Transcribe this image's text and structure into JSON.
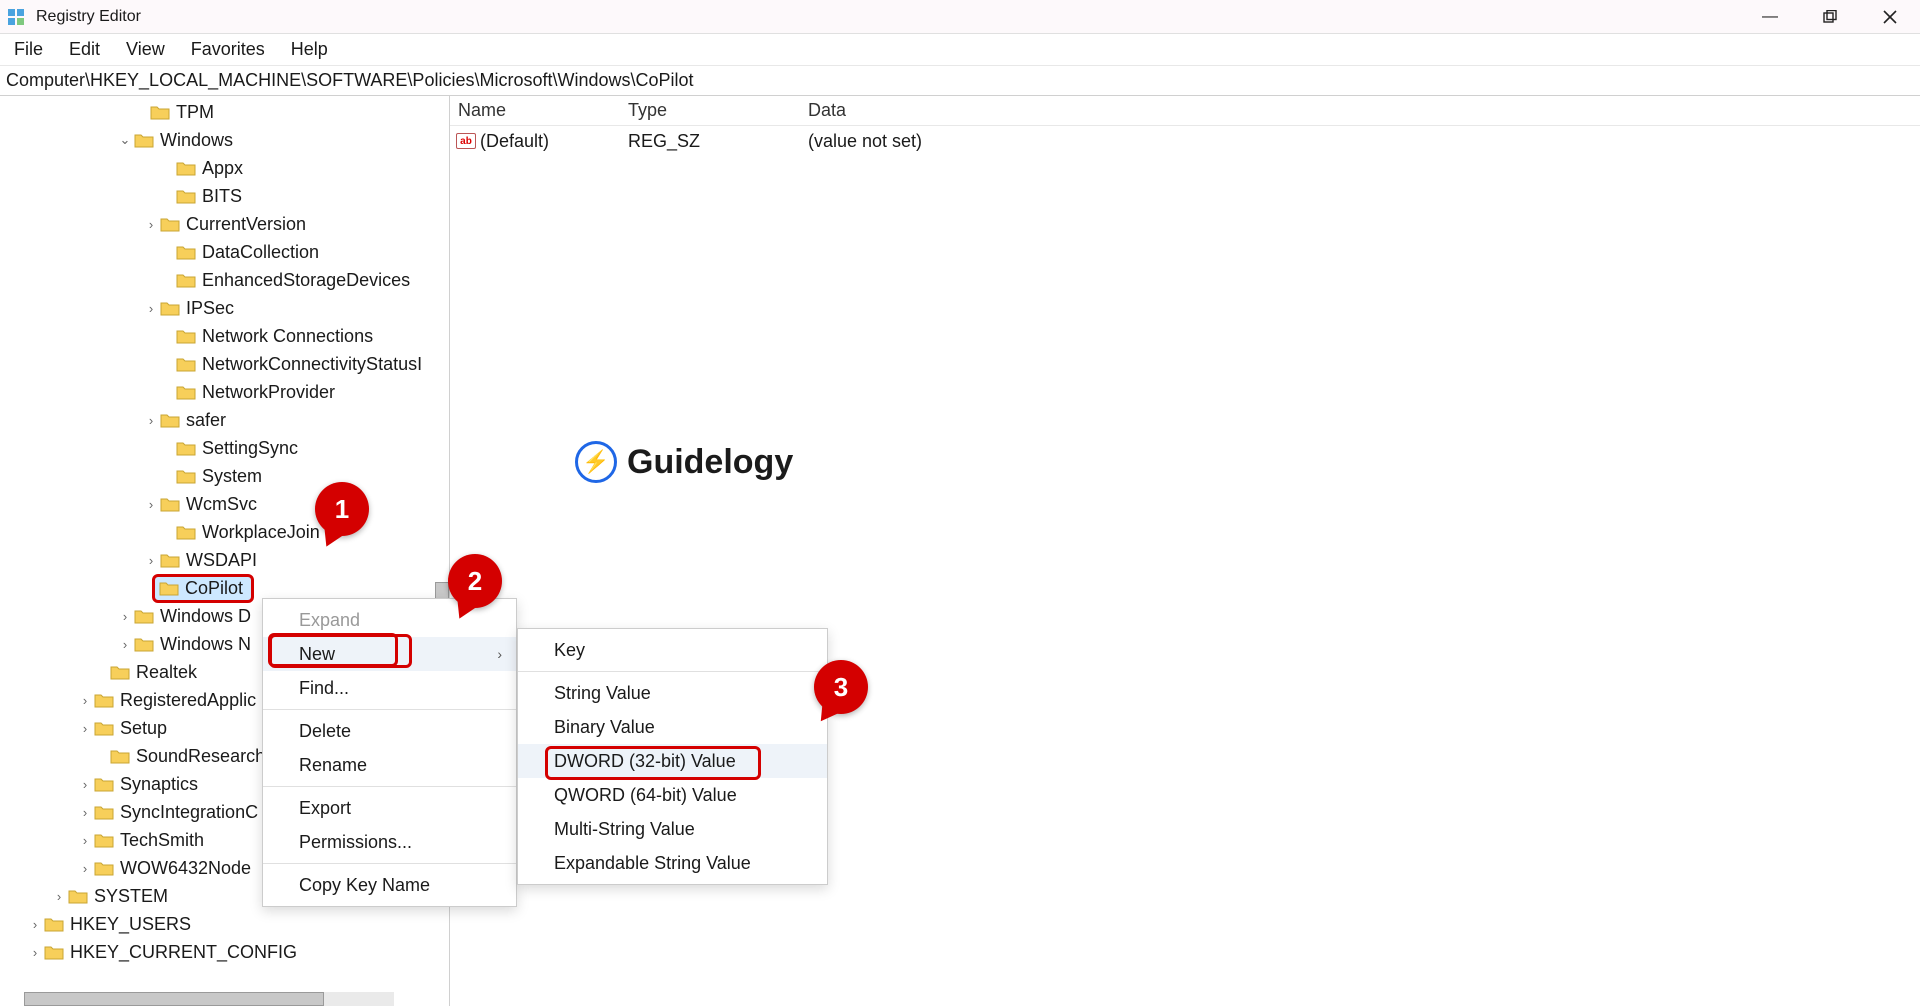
{
  "window": {
    "title": "Registry Editor"
  },
  "menu": {
    "file": "File",
    "edit": "Edit",
    "view": "View",
    "favorites": "Favorites",
    "help": "Help"
  },
  "address": "Computer\\HKEY_LOCAL_MACHINE\\SOFTWARE\\Policies\\Microsoft\\Windows\\CoPilot",
  "tree": {
    "tpm": "TPM",
    "windows": "Windows",
    "appx": "Appx",
    "bits": "BITS",
    "currentversion": "CurrentVersion",
    "datacollection": "DataCollection",
    "enhanced": "EnhancedStorageDevices",
    "ipsec": "IPSec",
    "netconn": "Network Connections",
    "netconnstat": "NetworkConnectivityStatusI",
    "netprov": "NetworkProvider",
    "safer": "safer",
    "settingsync": "SettingSync",
    "system": "System",
    "wcmsvc": "WcmSvc",
    "workplace": "WorkplaceJoin",
    "wsdapi": "WSDAPI",
    "copilot": "CoPilot",
    "windowsd": "Windows D",
    "windowsn": "Windows N",
    "realtek": "Realtek",
    "regapp": "RegisteredApplic",
    "setup": "Setup",
    "soundres": "SoundResearch",
    "synaptics": "Synaptics",
    "syncint": "SyncIntegrationC",
    "techsmith": "TechSmith",
    "wow64": "WOW6432Node",
    "hsystem": "SYSTEM",
    "hkeyusers": "HKEY_USERS",
    "hkeycc": "HKEY_CURRENT_CONFIG"
  },
  "list": {
    "h_name": "Name",
    "h_type": "Type",
    "h_data": "Data",
    "r0_name": "(Default)",
    "r0_type": "REG_SZ",
    "r0_data": "(value not set)"
  },
  "ctx1": {
    "expand": "Expand",
    "new": "New",
    "find": "Find...",
    "delete": "Delete",
    "rename": "Rename",
    "export": "Export",
    "permissions": "Permissions...",
    "copykey": "Copy Key Name"
  },
  "ctx2": {
    "key": "Key",
    "string": "String Value",
    "binary": "Binary Value",
    "dword": "DWORD (32-bit) Value",
    "qword": "QWORD (64-bit) Value",
    "multi": "Multi-String Value",
    "expand": "Expandable String Value"
  },
  "watermark": "Guidelogy",
  "badges": {
    "b1": "1",
    "b2": "2",
    "b3": "3"
  }
}
